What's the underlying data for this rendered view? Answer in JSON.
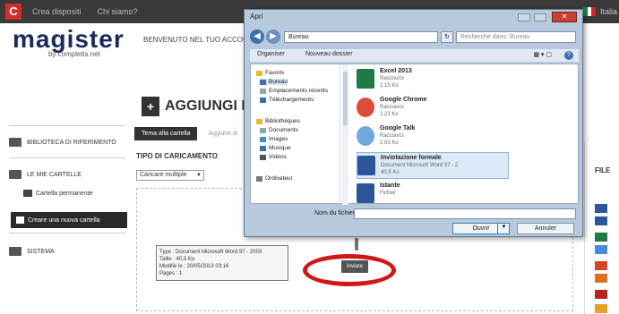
{
  "topbar": {
    "logo_letter": "C",
    "nav": [
      "Crea dispositi",
      "Chi siamo?"
    ],
    "user": "Italia"
  },
  "brand": {
    "name": "magister",
    "sub": "by completis.net"
  },
  "welcome": "BENVENUTO NEL TUO ACCOUNT PR",
  "sidebar": {
    "items": [
      "BIBLIOTECA DI RIFERIMENTO",
      "LE MIE CARTELLE",
      "SISTEMA"
    ],
    "sub": "Cartella permanente",
    "new_folder": "Creare una nuova cartella"
  },
  "main": {
    "title": "AGGIUNGI DEI D",
    "tab_active": "Tema alla cartella",
    "tab_inactive": "Aggiunti di",
    "upload_type": "TIPO DI CARICAMENTO",
    "upload_select": "Caricare multiple",
    "upload_button": "Inviare"
  },
  "right_panel": {
    "label": "FILE"
  },
  "dialog": {
    "title": "Apri",
    "path": "Bureau",
    "search_placeholder": "Recherche dans: Bureau",
    "toolbar": {
      "organize": "Organiser",
      "new_folder": "Nouveau dossier"
    },
    "nav_items": [
      {
        "label": "Favoris",
        "group": true
      },
      {
        "label": "Bureau",
        "selected": true
      },
      {
        "label": "Emplacements récents"
      },
      {
        "label": "Téléchargements"
      },
      {
        "label": "Bibliothèques",
        "group": true
      },
      {
        "label": "Documents"
      },
      {
        "label": "Images"
      },
      {
        "label": "Musique"
      },
      {
        "label": "Vidéos"
      },
      {
        "label": "Ordinateur",
        "group": true
      }
    ],
    "files": [
      {
        "name": "Excel 2013",
        "type": "Raccourci",
        "size": "2,15 Ko",
        "color": "#1f7a45"
      },
      {
        "name": "Google Chrome",
        "type": "Raccourci",
        "size": "2,23 Ko",
        "color": "#dd4b39"
      },
      {
        "name": "Google Talk",
        "type": "Raccourci",
        "size": "2,03 Ko",
        "color": "#6fa8dc"
      },
      {
        "name": "Inviotazione formale",
        "type": "Document Microsoft Word 97 - 2",
        "size": "40,5 Ko",
        "color": "#2b579a"
      },
      {
        "name": "Istante",
        "type": "Fichier",
        "size": "",
        "color": "#2b579a"
      }
    ],
    "tooltip": {
      "type": "Type : Document Microsoft Word 97 - 2003",
      "size": "Taille : 40,5 Ko",
      "modified": "Modifié le : 20/05/2013 03:16",
      "extra": "Pages : 1"
    },
    "filename_label": "Nom du fichier :",
    "open_label": "Ouvrir",
    "cancel_label": "Annuler"
  },
  "colors": {
    "accent": "#d01818",
    "brand": "#1a2a5c",
    "dialog": "#b6c9dd"
  }
}
